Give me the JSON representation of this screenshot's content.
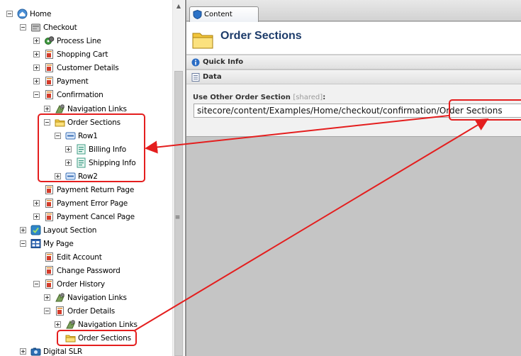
{
  "tree": {
    "items": [
      {
        "label": "Home",
        "icon": "home-icon",
        "expander": "minus"
      },
      {
        "label": "Checkout",
        "icon": "checkout-icon",
        "expander": "minus"
      },
      {
        "label": "Process Line",
        "icon": "process-line-icon",
        "expander": "plus"
      },
      {
        "label": "Shopping Cart",
        "icon": "page-icon",
        "expander": "plus"
      },
      {
        "label": "Customer Details",
        "icon": "page-icon",
        "expander": "plus"
      },
      {
        "label": "Payment",
        "icon": "page-icon",
        "expander": "plus"
      },
      {
        "label": "Confirmation",
        "icon": "page-icon",
        "expander": "minus"
      },
      {
        "label": "Navigation Links",
        "icon": "navigation-links-icon",
        "expander": "plus"
      },
      {
        "label": "Order Sections",
        "icon": "folder-icon",
        "expander": "minus"
      },
      {
        "label": "Row1",
        "icon": "row-icon",
        "expander": "minus"
      },
      {
        "label": "Billing Info",
        "icon": "form-icon",
        "expander": "plus"
      },
      {
        "label": "Shipping Info",
        "icon": "form-icon",
        "expander": "plus"
      },
      {
        "label": "Row2",
        "icon": "row-icon",
        "expander": "plus"
      },
      {
        "label": "Payment Return Page",
        "icon": "page-icon",
        "expander": "none"
      },
      {
        "label": "Payment Error Page",
        "icon": "page-icon",
        "expander": "plus"
      },
      {
        "label": "Payment Cancel Page",
        "icon": "page-icon",
        "expander": "plus"
      },
      {
        "label": "Layout Section",
        "icon": "layout-section-icon",
        "expander": "plus"
      },
      {
        "label": "My Page",
        "icon": "my-page-icon",
        "expander": "minus"
      },
      {
        "label": "Edit Account",
        "icon": "page-icon",
        "expander": "none"
      },
      {
        "label": "Change Password",
        "icon": "page-icon",
        "expander": "none"
      },
      {
        "label": "Order History",
        "icon": "page-icon",
        "expander": "minus"
      },
      {
        "label": "Navigation Links",
        "icon": "navigation-links-icon",
        "expander": "plus"
      },
      {
        "label": "Order Details",
        "icon": "page-icon",
        "expander": "minus"
      },
      {
        "label": "Navigation Links",
        "icon": "navigation-links-icon",
        "expander": "plus"
      },
      {
        "label": "Order Sections",
        "icon": "folder-icon",
        "expander": "none"
      },
      {
        "label": "Digital SLR",
        "icon": "camera-icon",
        "expander": "plus"
      }
    ]
  },
  "splitter_glyph": "≡",
  "scroll_up_glyph": "▲",
  "editor": {
    "tab_label": "Content",
    "title": "Order Sections",
    "sections": {
      "quick_info": "Quick Info",
      "data": "Data"
    },
    "field": {
      "label": "Use Other Order Section",
      "shared": "[shared]",
      "colon": ":",
      "value": "sitecore/content/Examples/Home/checkout/confirmation/Order Sections"
    }
  },
  "colors": {
    "annotation": "#e41e1e",
    "title": "#1c3b6a"
  }
}
